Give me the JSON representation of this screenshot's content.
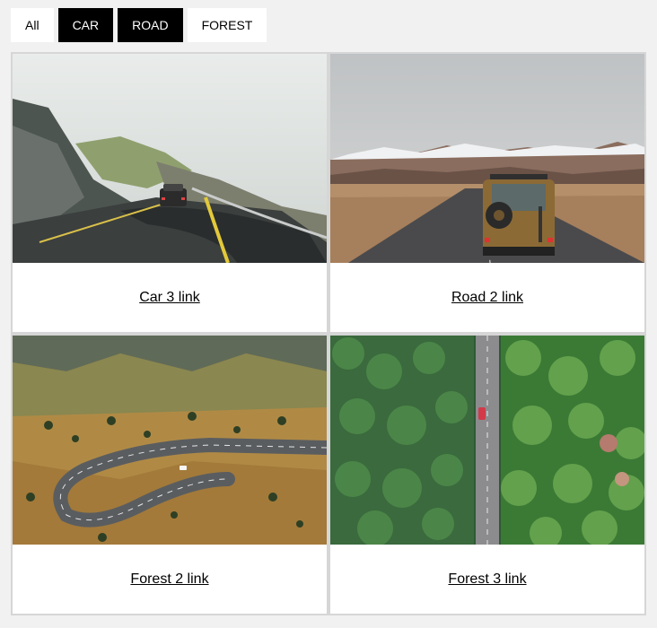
{
  "filters": [
    {
      "label": "All",
      "active": false
    },
    {
      "label": "CAR",
      "active": true
    },
    {
      "label": "ROAD",
      "active": true
    },
    {
      "label": "FOREST",
      "active": false
    }
  ],
  "cards": [
    {
      "link_text": "Car 3 link",
      "image": "mountain-road-car-photo"
    },
    {
      "link_text": "Road 2 link",
      "image": "desert-road-van-photo"
    },
    {
      "link_text": "Forest 2 link",
      "image": "winding-mountain-road-photo"
    },
    {
      "link_text": "Forest 3 link",
      "image": "forest-road-aerial-photo"
    }
  ],
  "colors": {
    "page_bg": "#f1f1f1",
    "active_filter_bg": "#000000",
    "inactive_filter_bg": "#ffffff",
    "card_bg": "#ffffff",
    "border": "#d6d6d6"
  }
}
